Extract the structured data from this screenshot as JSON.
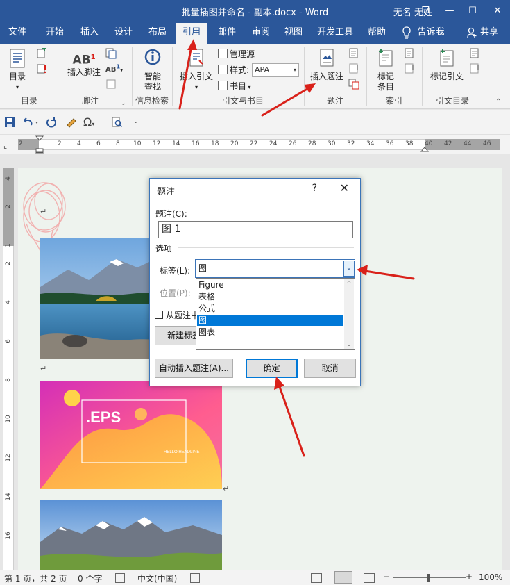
{
  "window": {
    "title": "批量插图并命名 - 副本.docx  -  Word",
    "user": "无名 无姓",
    "controls": [
      "❐",
      "—",
      "☐",
      "✕"
    ]
  },
  "tabs": {
    "items": [
      "文件",
      "开始",
      "插入",
      "设计",
      "布局",
      "引用",
      "邮件",
      "审阅",
      "视图",
      "开发工具",
      "帮助"
    ],
    "active": "引用",
    "tell_me": "告诉我",
    "share": "共享"
  },
  "ribbon": {
    "toc": "目录",
    "insert_footnote": "插入脚注",
    "smart_lookup_1": "智能",
    "smart_lookup_2": "查找",
    "insert_citation": "插入引文",
    "manage_sources": "管理源",
    "style_label": "样式:",
    "style_value": "APA",
    "bibliography": "书目",
    "insert_caption": "插入题注",
    "mark_entry_1": "标记",
    "mark_entry_2": "条目",
    "mark_citation": "标记引文",
    "groups": {
      "toc": "目录",
      "footnotes": "脚注",
      "research": "信息检索",
      "citations": "引文与书目",
      "captions": "题注",
      "index": "索引",
      "table_of_authorities": "引文目录"
    }
  },
  "ruler": {
    "h_ticks": [
      "2",
      "2",
      "4",
      "6",
      "8",
      "10",
      "12",
      "14",
      "16",
      "18",
      "20",
      "22",
      "24",
      "26",
      "28",
      "30",
      "32",
      "34",
      "36",
      "38",
      "40",
      "42",
      "44",
      "46"
    ],
    "v_ticks": [
      "4",
      "2",
      "1",
      "2",
      "4",
      "6",
      "8",
      "10",
      "12",
      "14",
      "16",
      "18",
      "20",
      "22"
    ]
  },
  "document": {
    "paragraph_mark": "↵",
    "eps_title": ".EPS",
    "eps_sub": "HELLO\nHEADLINE"
  },
  "dialog": {
    "title": "题注",
    "help": "?",
    "close": "✕",
    "caption_label": "题注(C):",
    "caption_value": "图  1",
    "options_label": "选项",
    "label_label": "标签(L):",
    "label_value": "图",
    "position_label": "位置(P):",
    "exclude_checkbox_label": "从题注中",
    "new_label_button": "新建标签",
    "dropdown_options": [
      "Figure",
      "表格",
      "公式",
      "图",
      "图表"
    ],
    "selected_option": "图",
    "autocaption_button": "自动插入题注(A)...",
    "ok_button": "确定",
    "cancel_button": "取消"
  },
  "status": {
    "page": "第 1 页，共 2 页",
    "words": "0 个字",
    "language": "中文(中国)",
    "zoom": "100%"
  },
  "colors": {
    "accent": "#2b579a",
    "arrow": "#d9211a",
    "selection": "#0078d7"
  }
}
